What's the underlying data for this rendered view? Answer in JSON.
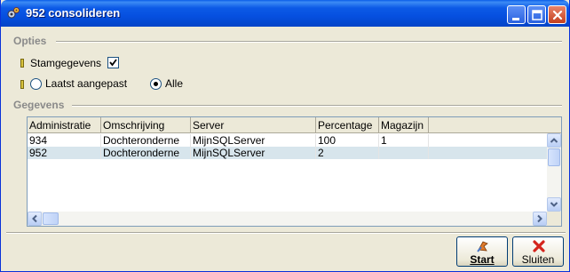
{
  "window": {
    "title": "952 consolideren"
  },
  "options": {
    "group_label": "Opties",
    "stamgegevens_label": "Stamgegevens",
    "stamgegevens_checked": true,
    "radio_last_label": "Laatst aangepast",
    "radio_all_label": "Alle",
    "selected": "Alle"
  },
  "data": {
    "group_label": "Gegevens",
    "columns": [
      "Administratie",
      "Omschrijving",
      "Server",
      "Percentage",
      "Magazijn"
    ],
    "rows": [
      [
        "934",
        "Dochteronderne",
        "MijnSQLServer",
        "100",
        "1"
      ],
      [
        "952",
        "Dochteronderne",
        "MijnSQLServer",
        "2",
        ""
      ]
    ]
  },
  "actions": {
    "start_label": "Start",
    "close_label": "Sluiten"
  },
  "colors": {
    "titlebar": "#0650e0",
    "selected_row": "#d7e5ec",
    "close_icon": "#d4241c"
  }
}
